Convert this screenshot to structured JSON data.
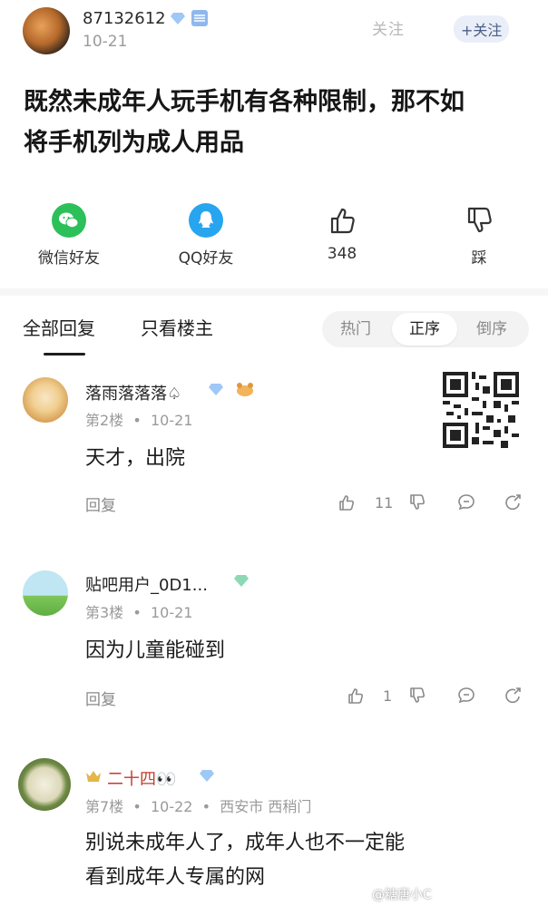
{
  "post": {
    "author": "87132612",
    "date": "10-21",
    "follow_ghost": "关注",
    "follow_label": "关注",
    "text_line1": "既然未成年人玩手机有各种限制，那不如",
    "text_line2": "将手机列为成人用品"
  },
  "share": {
    "wechat_label": "微信好友",
    "qq_label": "QQ好友",
    "like_count": "348",
    "dislike_label": "踩"
  },
  "tabs": {
    "all": "全部回复",
    "op_only": "只看楼主"
  },
  "sort": {
    "hot": "热门",
    "asc": "正序",
    "desc": "倒序",
    "selected": "正序"
  },
  "comments": [
    {
      "name": "落雨落落落♤",
      "floor": "第2楼",
      "date": "10-21",
      "text": "天才，出院",
      "reply": "回复",
      "likes": "11"
    },
    {
      "name": "贴吧用户_0D1...",
      "floor": "第3楼",
      "date": "10-21",
      "text": "因为儿童能碰到",
      "reply": "回复",
      "likes": "1"
    },
    {
      "name": "二十四👀",
      "floor": "第7楼",
      "date": "10-22",
      "location": "西安市 西稍门",
      "text_line1": "别说未成年人了，成年人也不一定能",
      "text_line2": "看到成年人专属的网"
    }
  ],
  "watermark": "@糖唐小C",
  "colors": {
    "wechat": "#2cc05a",
    "qq": "#27a5ef",
    "diamond": "#9ec8f5",
    "green_diamond": "#8fd8b6"
  },
  "icons": [
    "wechat-icon",
    "qq-icon",
    "thumbs-up-icon",
    "thumbs-down-icon",
    "comment-icon",
    "share-icon",
    "diamond-badge-icon",
    "qr-code"
  ]
}
